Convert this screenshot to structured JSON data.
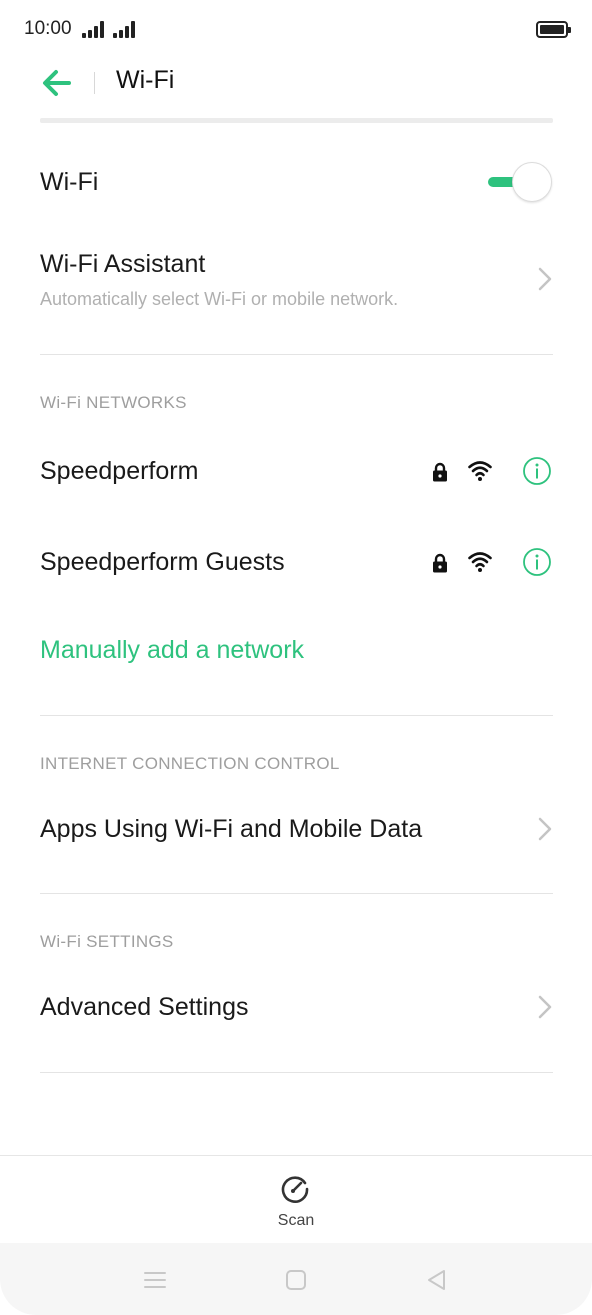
{
  "status_bar": {
    "time": "10:00"
  },
  "header": {
    "title": "Wi-Fi",
    "back_icon": "arrow-left-icon",
    "accent_color": "#2ec27e"
  },
  "wifi_toggle": {
    "label": "Wi-Fi",
    "state": "on"
  },
  "wifi_assistant": {
    "title": "Wi-Fi Assistant",
    "subtitle": "Automatically select Wi-Fi or mobile network."
  },
  "networks_section": {
    "header": "Wi-Fi NETWORKS",
    "items": [
      {
        "name": "Speedperform",
        "secured": true,
        "signal": "full"
      },
      {
        "name": "Speedperform Guests",
        "secured": true,
        "signal": "full"
      }
    ],
    "add_network": "Manually add a network"
  },
  "connection_section": {
    "header": "INTERNET CONNECTION CONTROL",
    "item": "Apps Using Wi-Fi and Mobile Data"
  },
  "settings_section": {
    "header": "Wi-Fi SETTINGS",
    "item": "Advanced Settings"
  },
  "bottom_bar": {
    "scan_label": "Scan"
  },
  "nav_bar": {
    "icons": [
      "menu-icon",
      "home-square-icon",
      "back-triangle-icon"
    ]
  }
}
